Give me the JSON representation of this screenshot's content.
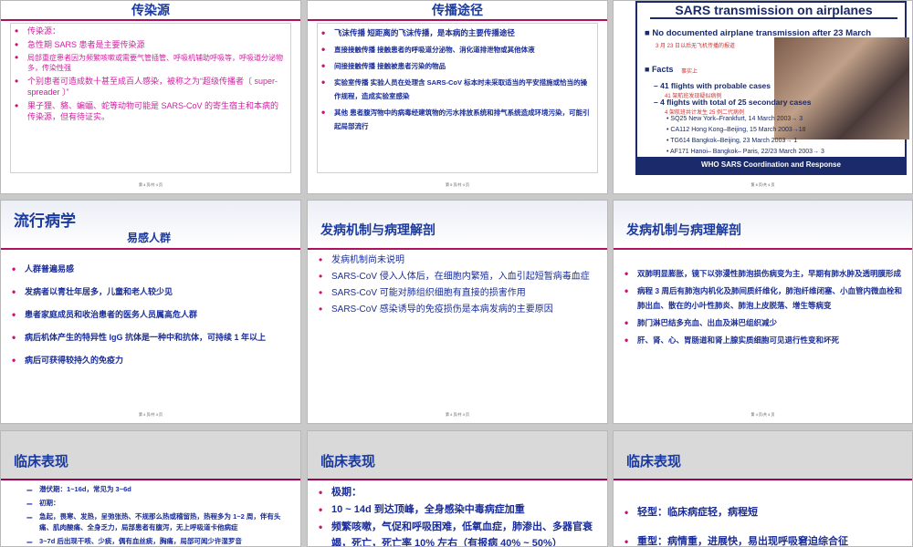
{
  "slides": {
    "s1": {
      "title": "传染源",
      "items": [
        "传染源：",
        "急性期 SARS 患者是主要传染源",
        "局部重症患者因为频繁咳嗽或需要气管插管、呼吸机辅助呼吸等，呼吸道分泌物多，传染性强",
        "个别患者可造成数十甚至成百人感染，被称之为“超级传播者〔 super-spreader 〕”",
        "果子狸、貉、蝙蝠、蛇等动物可能是 SARS-CoV 的寄生宿主和本病的传染源，但有待证实。"
      ],
      "footer": "第 4 页/共 4 页"
    },
    "s2": {
      "title": "传播途径",
      "items": [
        "飞沫传播 短距离的飞沫传播，是本病的主要传播途径",
        "直接接触传播 接触患者的呼吸道分泌物、消化道排泄物或其他体液",
        "间接接触传播 接触被患者污染的物品",
        "实验室传播 实验人员在处理含 SARS-CoV 标本时未采取适当的平安措施或恰当的操作规程，造成实验室感染",
        "其他 患者腹泻物中的病毒经建筑物的污水排放系统和排气系统造成环境污染，可能引起局部流行"
      ],
      "footer": "第 5 页/共 4 页"
    },
    "s3": {
      "title": "SARS transmission on airplanes",
      "line1": "No documented airplane transmission after 23 March",
      "line1_cn": "3 月 23 日以后无飞机传播的报道",
      "facts": "Facts",
      "facts_cn": "事实上",
      "probable": "41 flights with probable cases",
      "probable_cn": "41 架航班发现疑似病例",
      "secondary": "4 flights with total of 25 secondary cases",
      "secondary_cn": "4 架航班共计发生 25 例二代病例",
      "flights": [
        "SQ25 New York–Frankfurt, 14 March 2003→ 3",
        "CA112 Hong Kong–Beijing, 15 March 2003→18",
        "TG614 Bangkok–Beijing, 23 March 2003→ 1",
        "AF171 Hanoi– Bangkok– Paris, 22/23 March 2003→ 3"
      ],
      "footer": "WHO SARS  Coordination and Response",
      "page": "第 6 页/共 4 页"
    },
    "s4": {
      "title": "流行病学",
      "subtitle": "易感人群",
      "items": [
        "人群普遍易感",
        "发病者以青壮年居多，儿童和老人较少见",
        "患者家庭成员和收治患者的医务人员属高危人群",
        "病后机体产生的特异性 IgG 抗体是一种中和抗体，可持续 1 年以上",
        "病后可获得较持久的免疫力"
      ],
      "footer": "第 4 页/共 4 页"
    },
    "s5": {
      "title": "发病机制与病理解剖",
      "items": [
        "发病机制尚未说明",
        "SARS-CoV 侵入人体后，在细胞内繁殖，入血引起短暂病毒血症",
        "SARS-CoV 可能对肺组织细胞有直接的损害作用",
        "SARS-CoV 感染诱导的免疫损伤是本病发病的主要原因"
      ],
      "footer": "第 4 页/共 4 页"
    },
    "s6": {
      "title": "发病机制与病理解剖",
      "items": [
        "双肺明显膨胀，镜下以弥漫性肺泡损伤病变为主，早期有肺水肿及透明膜形成",
        "病程 3 周后有肺泡内机化及肺间质纤维化，肺泡纤维闭塞、小血管内微血栓和肺出血、散在的小叶性肺炎、肺泡上皮脱落、增生等病变",
        "肺门淋巴结多充血、出血及淋巴组织减少",
        "肝、肾、心、胃肠道和肾上腺实质细胞可见退行性变和坏死"
      ],
      "footer": "第 4 页/共 4 页"
    },
    "s7": {
      "title": "临床表现",
      "items": [
        "潜伏期：1~16d，常见为 3~6d",
        "初期：",
        "急起，畏寒、发热，呈弛张热、不规那么热或稽留热，热程多为 1~2 周，伴有头痛、肌肉酸痛、全身乏力，局部患者有腹泻，无上呼吸道卡他病症",
        "3~7d 后出现干咳、少痰，偶有血丝痰，胸痛，局部可闻少许湿罗音"
      ]
    },
    "s8": {
      "title": "临床表现",
      "items": [
        "极期：",
        "10 ~ 14d 到达顶峰，全身感染中毒病症加重",
        "频繁咳嗽，气促和呼吸困难，低氧血症，肺渗出、多器官衰竭，死亡，死亡率 10% 左右（有报病 40% ~ 50%）"
      ]
    },
    "s9": {
      "title": "临床表现",
      "items": [
        "轻型：临床病症轻，病程短",
        "重型：病情重，进展快，易出现呼吸窘迫综合征"
      ]
    }
  }
}
